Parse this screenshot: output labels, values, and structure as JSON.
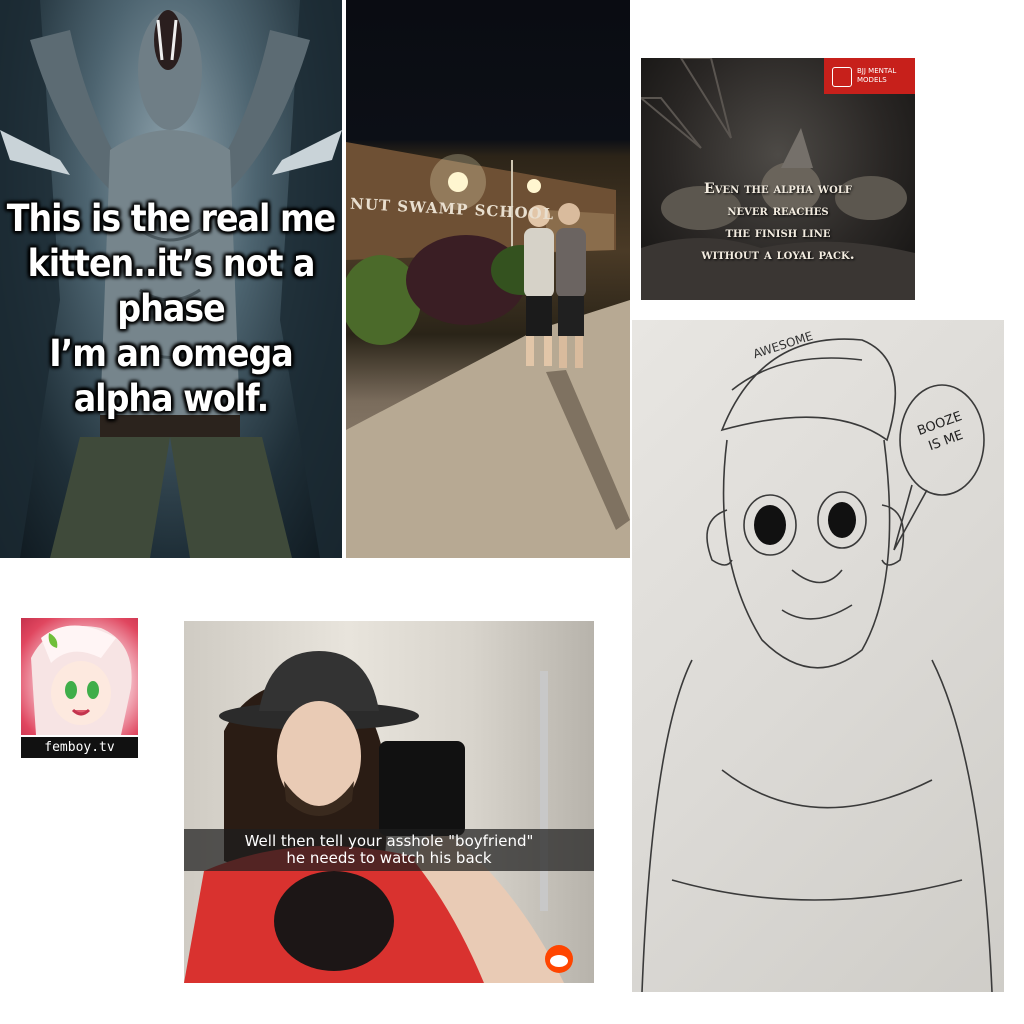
{
  "wolf_tile": {
    "caption_lines": [
      "This is the real me",
      "kitten..it’s not a phase",
      "I’m an omega alpha wolf."
    ]
  },
  "school_tile": {
    "sign": "NUT SWAMP SCHOOL"
  },
  "quote_tile": {
    "badge_lines": [
      "BJJ MENTAL",
      "MODELS"
    ],
    "quote_lines": [
      "Even the alpha wolf",
      "never reaches",
      "the finish line",
      "without a loyal pack."
    ]
  },
  "sketch_tile": {
    "hat_text": "AWESOME",
    "bubble_text": "BOOZE IS ME"
  },
  "logo_tile": {
    "label": "femboy.tv"
  },
  "selfie_tile": {
    "caption_lines": [
      "Well then tell your asshole \"boyfriend\"",
      "he needs to watch his back"
    ]
  },
  "colors": {
    "badge_red": "#c7201b",
    "logo_pink": "#e0465f",
    "shirt_red": "#d9322f"
  }
}
